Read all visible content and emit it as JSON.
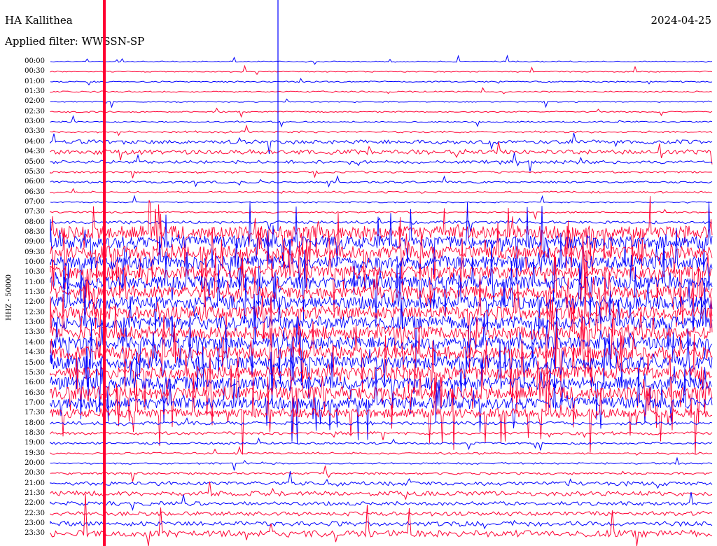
{
  "header": {
    "station": "HA Kallithea",
    "date": "2024-04-25",
    "filter": "Applied filter: WWSSN-SP"
  },
  "axis": {
    "ylabel": "HHZ - 50000"
  },
  "colors": {
    "trace_a": "#0000ff",
    "trace_b": "#ff0033",
    "background": "#ffffff",
    "text": "#000000"
  },
  "rows": [
    {
      "time": "00:00",
      "level": 0.05
    },
    {
      "time": "00:30",
      "level": 0.05
    },
    {
      "time": "01:00",
      "level": 0.07
    },
    {
      "time": "01:30",
      "level": 0.08
    },
    {
      "time": "02:00",
      "level": 0.06
    },
    {
      "time": "02:30",
      "level": 0.06
    },
    {
      "time": "03:00",
      "level": 0.08
    },
    {
      "time": "03:30",
      "level": 0.12
    },
    {
      "time": "04:00",
      "level": 0.3
    },
    {
      "time": "04:30",
      "level": 0.35
    },
    {
      "time": "05:00",
      "level": 0.22
    },
    {
      "time": "05:30",
      "level": 0.12
    },
    {
      "time": "06:00",
      "level": 0.14
    },
    {
      "time": "06:30",
      "level": 0.12
    },
    {
      "time": "07:00",
      "level": 0.07
    },
    {
      "time": "07:30",
      "level": 0.1
    },
    {
      "time": "08:00",
      "level": 0.2
    },
    {
      "time": "08:30",
      "level": 1.0
    },
    {
      "time": "09:00",
      "level": 1.0
    },
    {
      "time": "09:30",
      "level": 1.0
    },
    {
      "time": "10:00",
      "level": 1.0
    },
    {
      "time": "10:30",
      "level": 1.0
    },
    {
      "time": "11:00",
      "level": 1.0
    },
    {
      "time": "11:30",
      "level": 1.0
    },
    {
      "time": "12:00",
      "level": 1.0
    },
    {
      "time": "12:30",
      "level": 1.0
    },
    {
      "time": "13:00",
      "level": 1.0
    },
    {
      "time": "13:30",
      "level": 1.0
    },
    {
      "time": "14:00",
      "level": 1.0
    },
    {
      "time": "14:30",
      "level": 1.0
    },
    {
      "time": "15:00",
      "level": 1.0
    },
    {
      "time": "15:30",
      "level": 1.0
    },
    {
      "time": "16:00",
      "level": 1.0
    },
    {
      "time": "16:30",
      "level": 1.0
    },
    {
      "time": "17:00",
      "level": 0.9
    },
    {
      "time": "17:30",
      "level": 0.7
    },
    {
      "time": "18:00",
      "level": 0.25
    },
    {
      "time": "18:30",
      "level": 0.2
    },
    {
      "time": "19:00",
      "level": 0.15
    },
    {
      "time": "19:30",
      "level": 0.12
    },
    {
      "time": "20:00",
      "level": 0.1
    },
    {
      "time": "20:30",
      "level": 0.15
    },
    {
      "time": "21:00",
      "level": 0.3
    },
    {
      "time": "21:30",
      "level": 0.35
    },
    {
      "time": "22:00",
      "level": 0.28
    },
    {
      "time": "22:30",
      "level": 0.3
    },
    {
      "time": "23:00",
      "level": 0.35
    },
    {
      "time": "23:30",
      "level": 0.5
    }
  ]
}
